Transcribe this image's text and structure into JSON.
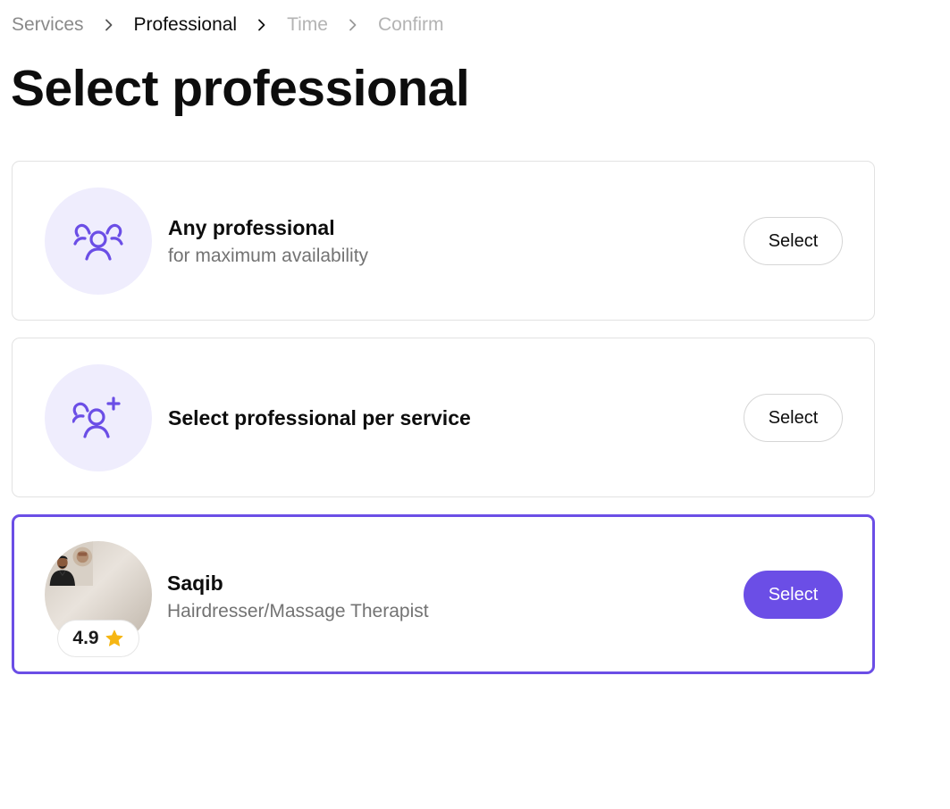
{
  "breadcrumb": {
    "items": [
      "Services",
      "Professional",
      "Time",
      "Confirm"
    ]
  },
  "page": {
    "title": "Select professional"
  },
  "options": [
    {
      "title": "Any professional",
      "subtitle": "for maximum availability",
      "icon": "users-group-icon",
      "button_label": "Select",
      "selected": false
    },
    {
      "title": "Select professional per service",
      "icon": "user-add-icon",
      "button_label": "Select",
      "selected": false
    },
    {
      "title": "Saqib",
      "subtitle": "Hairdresser/Massage Therapist",
      "rating": "4.9",
      "icon": "star-icon",
      "button_label": "Select",
      "selected": true
    }
  ],
  "colors": {
    "accent": "#6b4ee6",
    "icon_bg": "#efedfd",
    "star": "#f6b613"
  }
}
